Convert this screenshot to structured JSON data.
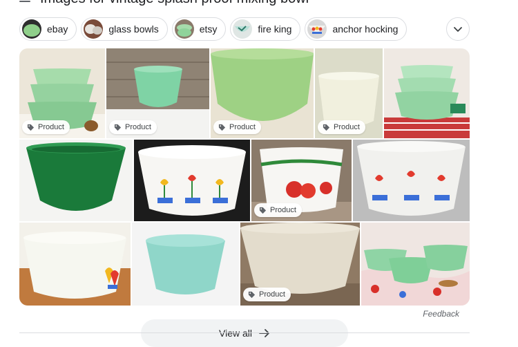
{
  "header": {
    "title": "Images for vintage splash proof mixing bowl"
  },
  "chips": [
    {
      "label": "ebay",
      "thumb_color": "#8fcf8a"
    },
    {
      "label": "glass bowls",
      "thumb_color": "#c9c3bb"
    },
    {
      "label": "etsy",
      "thumb_color": "#9fd6a0"
    },
    {
      "label": "fire king",
      "thumb_color": "#b9e0d8"
    },
    {
      "label": "anchor hocking",
      "thumb_color": "#f0efe8"
    }
  ],
  "grid": {
    "badge_label": "Product",
    "tiles": [
      {
        "desc": "stacked jadeite bowls",
        "badge": true,
        "bg": "#ece6d9",
        "bowl": "#9bd3a3"
      },
      {
        "desc": "jadeite bowl on wood",
        "badge": true,
        "bg": "#8f8374",
        "bowl": "#7fd3a5"
      },
      {
        "desc": "large green bowl",
        "badge": true,
        "bg": "#e9e3d3",
        "bowl": "#9ed184"
      },
      {
        "desc": "pale bowl",
        "badge": true,
        "bg": "#dcdcc9",
        "bowl": "#f1f0de"
      },
      {
        "desc": "jadeite bowl set",
        "badge": false,
        "bg": "#efe9e3",
        "bowl": "#a9e0b5"
      },
      {
        "desc": "forest green bowl",
        "badge": false,
        "bg": "#f4f4f2",
        "bowl": "#1a7a3a"
      },
      {
        "desc": "tulip milk glass bowl",
        "badge": false,
        "bg": "#1c1c1c",
        "bowl": "#f7f6f3"
      },
      {
        "desc": "apple milk glass bowl",
        "badge": true,
        "bg": "#8a7a6a",
        "bowl": "#f7f6f3"
      },
      {
        "desc": "tulip bowl grey",
        "badge": false,
        "bg": "#bdbdbd",
        "bowl": "#f1f1ee"
      },
      {
        "desc": "tulip bowl wood",
        "badge": false,
        "bg": "#c07a3e",
        "bowl": "#f6f7f0"
      },
      {
        "desc": "turquoise bowl",
        "badge": false,
        "bg": "#f4f4f4",
        "bowl": "#8fd6c9"
      },
      {
        "desc": "ivory bowl",
        "badge": true,
        "bg": "#8f7a64",
        "bowl": "#e3dccc"
      },
      {
        "desc": "green bowls on tablecloth",
        "badge": false,
        "bg": "#efe6e2",
        "bowl": "#7fcf98"
      }
    ]
  },
  "feedback_label": "Feedback",
  "view_all": {
    "label": "View all"
  }
}
